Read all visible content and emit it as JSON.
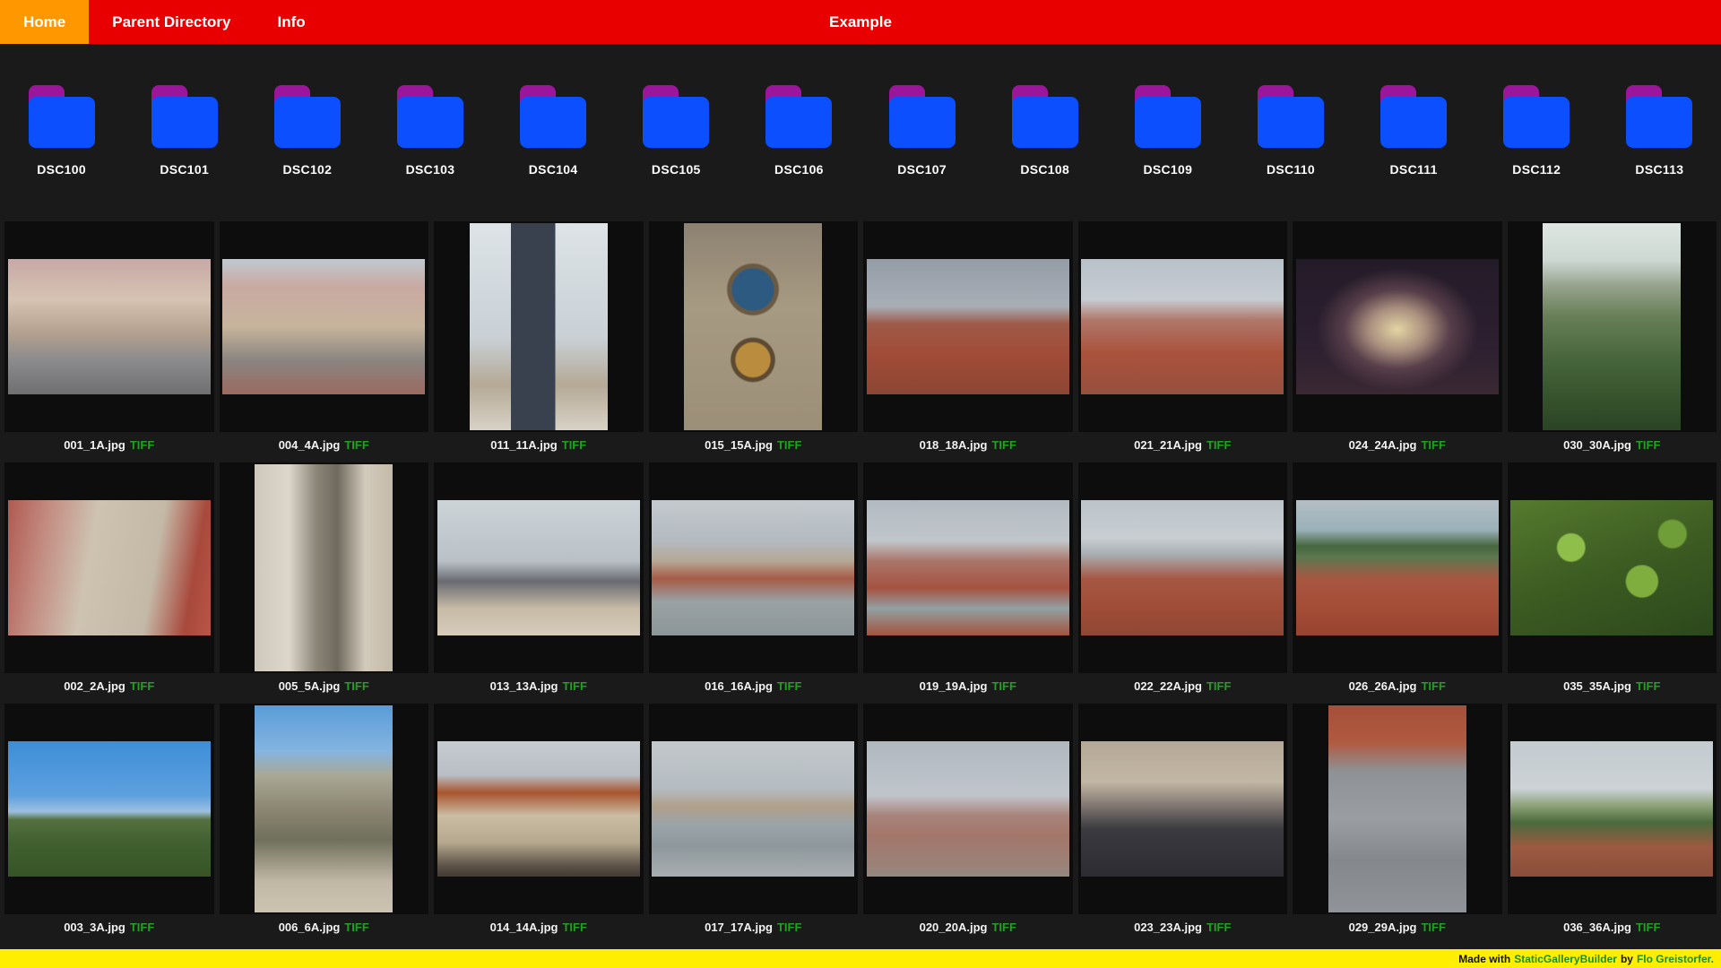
{
  "nav": {
    "title": "Example",
    "items": [
      {
        "label": "Home",
        "active": true
      },
      {
        "label": "Parent Directory",
        "active": false
      },
      {
        "label": "Info",
        "active": false
      }
    ]
  },
  "colors": {
    "nav_background": "#e80000",
    "nav_active_tab": "#ff9800",
    "page_background": "#1a1a1a",
    "tile_background": "#0d0d0d",
    "folder_body": "#0b4fff",
    "folder_tab": "#9b169b",
    "format_link_green": "#1fa21f",
    "footer_background": "#ffee00"
  },
  "folders": [
    "DSC100",
    "DSC101",
    "DSC102",
    "DSC103",
    "DSC104",
    "DSC105",
    "DSC106",
    "DSC107",
    "DSC108",
    "DSC109",
    "DSC110",
    "DSC111",
    "DSC112",
    "DSC113"
  ],
  "gallery": {
    "rows": [
      [
        {
          "file": "001_1A.jpg",
          "tag": "TIFF",
          "orient": "landscape",
          "bg": "linear-gradient(180deg,#c7a9a6 0%,#d6c3b2 30%,#b3a08e 55%,#8b8b8d 75%,#6f6f72 100%)"
        },
        {
          "file": "004_4A.jpg",
          "tag": "TIFF",
          "orient": "landscape",
          "bg": "linear-gradient(180deg,#bfc9d2 0%,#c9a9a2 20%,#c7b49c 50%,#8a8480 75%,#9b6a60 100%)"
        },
        {
          "file": "011_11A.jpg",
          "tag": "TIFF",
          "orient": "portrait",
          "bg": "linear-gradient(90deg,rgba(0,0,0,0) 30%,#39404e 30%,#39404e 62%,rgba(0,0,0,0) 62%),linear-gradient(180deg,#dde3e7 0%,#c9d1d6 55%,#b5a996 78%,#d8d2c6 100%)"
        },
        {
          "file": "015_15A.jpg",
          "tag": "TIFF",
          "orient": "portrait",
          "bg": "radial-gradient(circle at 50% 32%,#2c5a80 0 13%,#6a5a44 14% 16%,rgba(0,0,0,0) 17%),radial-gradient(circle at 50% 66%,#b98c3e 0 11%,#5c4a33 12% 14%,rgba(0,0,0,0) 15%),linear-gradient(180deg,#8d8272 0%,#a79a82 40%,#9c8f77 100%)"
        },
        {
          "file": "018_18A.jpg",
          "tag": "TIFF",
          "orient": "landscape",
          "bg": "linear-gradient(180deg,#949ca6 0%,#a8aeb6 35%,#9e5a48 48%,#a14c38 70%,#8c4634 100%)"
        },
        {
          "file": "021_21A.jpg",
          "tag": "TIFF",
          "orient": "landscape",
          "bg": "linear-gradient(180deg,#b9c1c9 0%,#c6ccd2 30%,#b0786a 45%,#aa523c 70%,#96503e 100%)"
        },
        {
          "file": "024_24A.jpg",
          "tag": "TIFF",
          "orient": "landscape",
          "bg": "radial-gradient(ellipse 40% 45% at 50% 52%,#e4d4a4 0%,#a98f7e 35%,#583f4a 65%,rgba(0,0,0,0) 100%),linear-gradient(180deg,#241b28 0%,#2c1f30 60%,#3a2833 100%)"
        },
        {
          "file": "030_30A.jpg",
          "tag": "TIFF",
          "orient": "portrait",
          "bg": "linear-gradient(180deg,#dee6e2 0%,#cdd8d2 18%,#96a48e 30%,#687f58 45%,#48663c 65%,#35522c 85%,#2a4424 100%)"
        }
      ],
      [
        {
          "file": "002_2A.jpg",
          "tag": "TIFF",
          "orient": "landscape",
          "bg": "linear-gradient(100deg,#b05a50 0%,#c28a80 18%,#cec2b0 40%,#c4b8a6 70%,#a8493c 88%,#b85548 100%)"
        },
        {
          "file": "005_5A.jpg",
          "tag": "TIFF",
          "orient": "portrait",
          "bg": "linear-gradient(90deg,#cfc8bc 0%,#ddd6ca 25%,#8b8578 45%,#6f6a5e 60%,#d2cabc 80%,#c4baa8 100%)"
        },
        {
          "file": "013_13A.jpg",
          "tag": "TIFF",
          "orient": "landscape",
          "bg": "linear-gradient(180deg,#cdd4d8 0%,#b9c1c7 45%,#6a6a72 60%,#c7bba6 80%,#d6ccba 100%)"
        },
        {
          "file": "016_16A.jpg",
          "tag": "TIFF",
          "orient": "landscape",
          "bg": "linear-gradient(180deg,#c4cace 0%,#b3bac0 30%,#b6a794 45%,#a65b46 58%,#9aa2a4 75%,#8c9598 100%)"
        },
        {
          "file": "019_19A.jpg",
          "tag": "TIFF",
          "orient": "landscape",
          "bg": "linear-gradient(180deg,#b2bac1 0%,#c0c6cb 30%,#a9766a 45%,#a65240 65%,#93a0a2 80%,#a2543c 100%)"
        },
        {
          "file": "022_22A.jpg",
          "tag": "TIFF",
          "orient": "landscape",
          "bg": "linear-gradient(180deg,#bcc4ca 0%,#c8ced2 28%,#a8aeb2 40%,#a65844 58%,#a04c38 80%,#8e4834 100%)"
        },
        {
          "file": "026_26A.jpg",
          "tag": "TIFF",
          "orient": "landscape",
          "bg": "linear-gradient(180deg,#b4bfc5 0%,#9ab0b8 22%,#46663e 34%,#5c7850 42%,#a85741 58%,#a44c36 80%,#964430 100%)"
        },
        {
          "file": "035_35A.jpg",
          "tag": "TIFF",
          "orient": "landscape",
          "bg": "radial-gradient(circle at 30% 35%,#8fbf4a 0 8%,rgba(0,0,0,0) 9%),radial-gradient(circle at 65% 60%,#7fae3f 0 10%,rgba(0,0,0,0) 11%),radial-gradient(circle at 80% 25%,#6f9e38 0 7%,rgba(0,0,0,0) 8%),linear-gradient(160deg,#567a2e 0%,#3c5c22 50%,#2c481c 100%)"
        }
      ],
      [
        {
          "file": "003_3A.jpg",
          "tag": "TIFF",
          "orient": "landscape",
          "bg": "linear-gradient(180deg,#3d8ed8 0%,#5da0de 40%,#9cc0e0 52%,#55703f 58%,#41602f 75%,#365426 100%)"
        },
        {
          "file": "006_6A.jpg",
          "tag": "TIFF",
          "orient": "portrait",
          "bg": "linear-gradient(180deg,#5a9cd8 0%,#84b4e0 22%,#a8a894 34%,#8c8672 50%,#70705c 65%,#c0b8a4 85%,#ccc4b0 100%)"
        },
        {
          "file": "014_14A.jpg",
          "tag": "TIFF",
          "orient": "landscape",
          "bg": "linear-gradient(180deg,#c6cbd0 0%,#b8bec4 25%,#a8542e 38%,#cbbda4 55%,#b5a88e 75%,#5c5248 92%,#433c34 100%)"
        },
        {
          "file": "017_17A.jpg",
          "tag": "TIFF",
          "orient": "landscape",
          "bg": "linear-gradient(180deg,#c2c8cc 0%,#b5bcc1 35%,#b0a08a 48%,#9aa4a8 62%,#8e989c 78%,#a8aeb0 100%)"
        },
        {
          "file": "020_20A.jpg",
          "tag": "TIFF",
          "orient": "landscape",
          "bg": "linear-gradient(180deg,#b0b8bf 0%,#bfc5cb 40%,#a8837a 55%,#a3766a 70%,#97867e 100%)"
        },
        {
          "file": "023_23A.jpg",
          "tag": "TIFF",
          "orient": "landscape",
          "bg": "linear-gradient(180deg,#b5a896 0%,#c2b6a4 30%,#8a8078 45%,#3a3a40 65%,#2c2c32 100%)"
        },
        {
          "file": "029_29A.jpg",
          "tag": "TIFF",
          "orient": "portrait",
          "bg": "linear-gradient(180deg,#a4503a 0%,#b05a40 18%,#8e9296 32%,#9a9ea2 55%,#84888c 75%,#90949a 100%)"
        },
        {
          "file": "036_36A.jpg",
          "tag": "TIFF",
          "orient": "landscape",
          "bg": "linear-gradient(180deg,#c3cbd0 0%,#ccd2d6 35%,#8ba076 48%,#4c6a3c 60%,#9c5a42 78%,#8a4e3a 100%)"
        }
      ]
    ]
  },
  "footer": {
    "made_with": "Made with",
    "tool": "StaticGalleryBuilder",
    "by": "by",
    "author": "Flo Greistorfer."
  }
}
